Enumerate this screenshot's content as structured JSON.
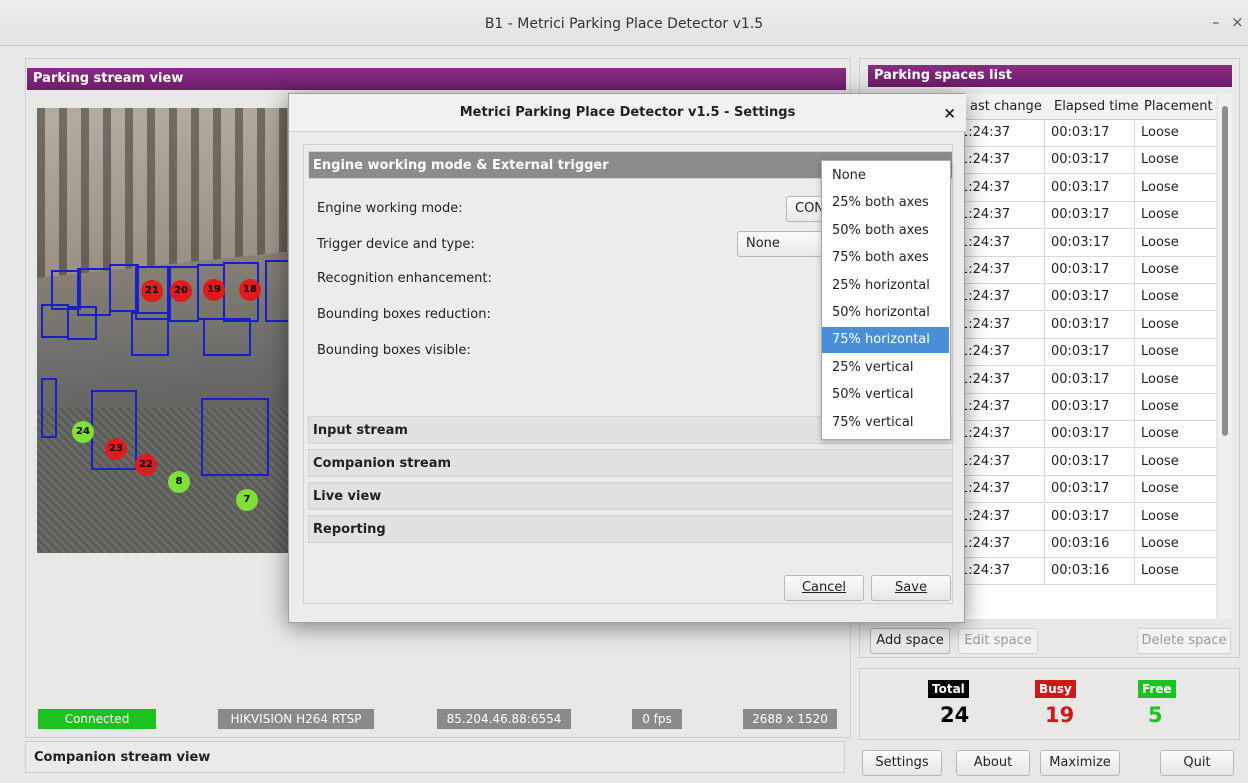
{
  "window": {
    "title": "B1 - Metrici Parking Place Detector v1.5",
    "minimize": "–",
    "close": "×"
  },
  "stream_view": {
    "title": "Parking stream view",
    "markers": {
      "busy": [
        "21",
        "20",
        "19",
        "18",
        "23",
        "22"
      ],
      "free": [
        "24",
        "8",
        "7"
      ]
    },
    "status": {
      "connected": "Connected",
      "camera": "HIKVISION H264 RTSP",
      "address": "85.204.46.88:6554",
      "fps": "0 fps",
      "resolution": "2688 x 1520"
    }
  },
  "companion_view": {
    "title": "Companion stream view"
  },
  "spaces_list": {
    "title": "Parking spaces list",
    "columns": [
      "ast change",
      "Elapsed time",
      "Placement"
    ],
    "rows": [
      [
        "1:24:37",
        "00:03:17",
        "Loose"
      ],
      [
        "1:24:37",
        "00:03:17",
        "Loose"
      ],
      [
        "1:24:37",
        "00:03:17",
        "Loose"
      ],
      [
        "1:24:37",
        "00:03:17",
        "Loose"
      ],
      [
        "1:24:37",
        "00:03:17",
        "Loose"
      ],
      [
        "1:24:37",
        "00:03:17",
        "Loose"
      ],
      [
        "1:24:37",
        "00:03:17",
        "Loose"
      ],
      [
        "1:24:37",
        "00:03:17",
        "Loose"
      ],
      [
        "1:24:37",
        "00:03:17",
        "Loose"
      ],
      [
        "1:24:37",
        "00:03:17",
        "Loose"
      ],
      [
        "1:24:37",
        "00:03:17",
        "Loose"
      ],
      [
        "1:24:37",
        "00:03:17",
        "Loose"
      ],
      [
        "1:24:37",
        "00:03:17",
        "Loose"
      ],
      [
        "1:24:37",
        "00:03:17",
        "Loose"
      ],
      [
        "1:24:37",
        "00:03:17",
        "Loose"
      ],
      [
        "1:24:37",
        "00:03:16",
        "Loose"
      ],
      [
        "1:24:37",
        "00:03:16",
        "Loose"
      ]
    ],
    "buttons": {
      "add": "Add space",
      "edit": "Edit space",
      "delete": "Delete space"
    }
  },
  "counts": {
    "total_label": "Total",
    "total": "24",
    "busy_label": "Busy",
    "busy": "19",
    "free_label": "Free",
    "free": "5"
  },
  "bottom_buttons": {
    "settings": "Settings",
    "about": "About",
    "maximize": "Maximize",
    "quit": "Quit"
  },
  "settings_dialog": {
    "title": "Metrici Parking Place Detector v1.5 - Settings",
    "close": "×",
    "section_engine": "Engine working mode & External trigger",
    "labels": {
      "engine_mode": "Engine working mode:",
      "trigger": "Trigger device and type:",
      "recognition": "Recognition enhancement:",
      "bbox_reduction": "Bounding boxes reduction:",
      "bbox_visible": "Bounding boxes visible:"
    },
    "engine_mode_value": "CON",
    "trigger_value": "None",
    "sections": [
      "Input stream",
      "Companion stream",
      "Live view",
      "Reporting"
    ],
    "cancel": "Cancel",
    "save": "Save"
  },
  "dropdown": {
    "options": [
      "None",
      "25% both axes",
      "50% both axes",
      "75% both axes",
      "25% horizontal",
      "50% horizontal",
      "75% horizontal",
      "25% vertical",
      "50% vertical",
      "75% vertical"
    ],
    "selected": "75% horizontal"
  },
  "colors": {
    "accent": "#7a2477",
    "busy": "#e01b1b",
    "free": "#1ec21e",
    "selection": "#4a90d9"
  }
}
